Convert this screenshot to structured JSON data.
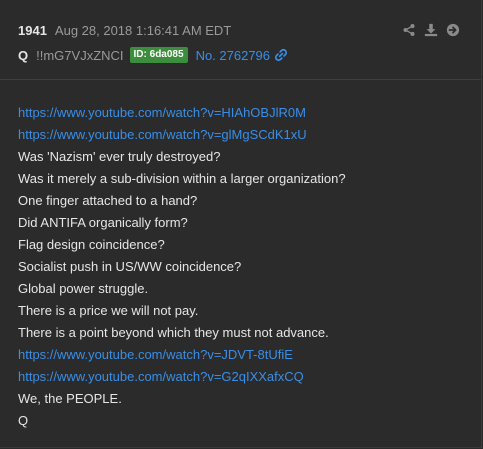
{
  "post": {
    "number": "1941",
    "date": "Aug 28, 2018 1:16:41 AM EDT",
    "author": "Q",
    "tripcode": "!!mG7VJxZNCI",
    "id_badge": "ID: 6da085",
    "post_no": "No. 2762796"
  },
  "actions": [
    {
      "icon": "share-icon"
    },
    {
      "icon": "download-icon"
    },
    {
      "icon": "arrow-right-circle-icon"
    }
  ],
  "lines": [
    {
      "text": "https://www.youtube.com/watch?v=HIAhOBJlR0M",
      "type": "link"
    },
    {
      "text": "https://www.youtube.com/watch?v=glMgSCdK1xU",
      "type": "link"
    },
    {
      "text": "Was 'Nazism' ever truly destroyed?",
      "type": "text"
    },
    {
      "text": "Was it merely a sub-division within a larger organization?",
      "type": "text"
    },
    {
      "text": "One finger attached to a hand?",
      "type": "text"
    },
    {
      "text": "Did ANTIFA organically form?",
      "type": "text"
    },
    {
      "text": "Flag design coincidence?",
      "type": "text"
    },
    {
      "text": "Socialist push in US/WW coincidence?",
      "type": "text"
    },
    {
      "text": "Global power struggle.",
      "type": "text"
    },
    {
      "text": "There is a price we will not pay.",
      "type": "text"
    },
    {
      "text": "There is a point beyond which they must not advance.",
      "type": "text"
    },
    {
      "text": "https://www.youtube.com/watch?v=JDVT-8tUfiE",
      "type": "link"
    },
    {
      "text": "https://www.youtube.com/watch?v=G2qIXXafxCQ",
      "type": "link"
    },
    {
      "text": "We, the PEOPLE.",
      "type": "text"
    },
    {
      "text": "Q",
      "type": "text"
    }
  ],
  "colors": {
    "background": "#2b2b2b",
    "text": "#e6e6e6",
    "muted": "#9a9a9a",
    "link": "#3a8ee6",
    "id_badge": "#3c8d3c"
  }
}
